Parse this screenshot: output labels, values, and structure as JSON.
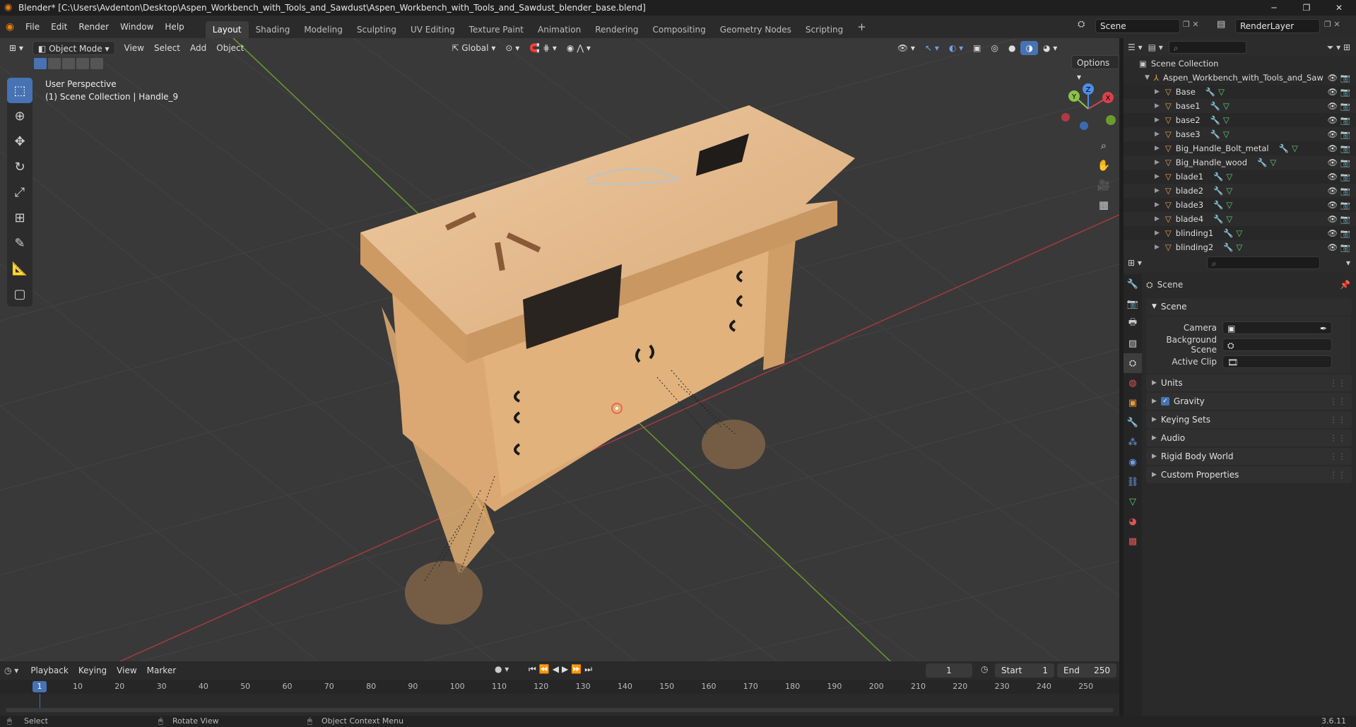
{
  "window": {
    "title": "Blender* [C:\\Users\\Avdenton\\Desktop\\Aspen_Workbench_with_Tools_and_Sawdust\\Aspen_Workbench_with_Tools_and_Sawdust_blender_base.blend]",
    "minimize": "─",
    "maximize": "❐",
    "close": "✕"
  },
  "menu": {
    "file": "File",
    "edit": "Edit",
    "render": "Render",
    "window": "Window",
    "help": "Help"
  },
  "workspaces": [
    "Layout",
    "Shading",
    "Modeling",
    "Sculpting",
    "UV Editing",
    "Texture Paint",
    "Animation",
    "Rendering",
    "Compositing",
    "Geometry Nodes",
    "Scripting"
  ],
  "workspace_add": "+",
  "scene_field": "Scene",
  "view_layer_field": "RenderLayer",
  "viewport": {
    "mode": "Object Mode",
    "menus": [
      "View",
      "Select",
      "Add",
      "Object"
    ],
    "orientation": "Global",
    "options": "Options",
    "overlay_line1": "User Perspective",
    "overlay_line2": "(1) Scene Collection | Handle_9",
    "gizmo_x": "X",
    "gizmo_y": "Y",
    "gizmo_z": "Z"
  },
  "outliner": {
    "root": "Scene Collection",
    "collection": "Aspen_Workbench_with_Tools_and_Saw",
    "objects": [
      "Base",
      "base1",
      "base2",
      "base3",
      "Big_Handle_Bolt_metal",
      "Big_Handle_wood",
      "blade1",
      "blade2",
      "blade3",
      "blade4",
      "blinding1",
      "blinding2"
    ]
  },
  "properties": {
    "context": "Scene",
    "section": "Scene",
    "camera_label": "Camera",
    "background_label": "Background Scene",
    "clip_label": "Active Clip",
    "panels": [
      "Units",
      "Gravity",
      "Keying Sets",
      "Audio",
      "Rigid Body World",
      "Custom Properties"
    ],
    "gravity_checked": true
  },
  "timeline": {
    "menus": [
      "Playback",
      "Keying",
      "View",
      "Marker"
    ],
    "current_frame": "1",
    "start_label": "Start",
    "start": "1",
    "end_label": "End",
    "end": "250",
    "ruler": [
      "10",
      "20",
      "30",
      "40",
      "50",
      "60",
      "70",
      "80",
      "90",
      "100",
      "110",
      "120",
      "130",
      "140",
      "150",
      "160",
      "170",
      "180",
      "190",
      "200",
      "210",
      "220",
      "230",
      "240",
      "250"
    ],
    "playhead": "1"
  },
  "status": {
    "select": "Select",
    "rotate": "Rotate View",
    "context_menu": "Object Context Menu",
    "version": "3.6.11"
  },
  "colors": {
    "accent": "#4772b3",
    "x_axis": "#d9414d",
    "y_axis": "#8bc34a",
    "z_axis": "#4d8ee8",
    "wood": "#e4b98a"
  }
}
